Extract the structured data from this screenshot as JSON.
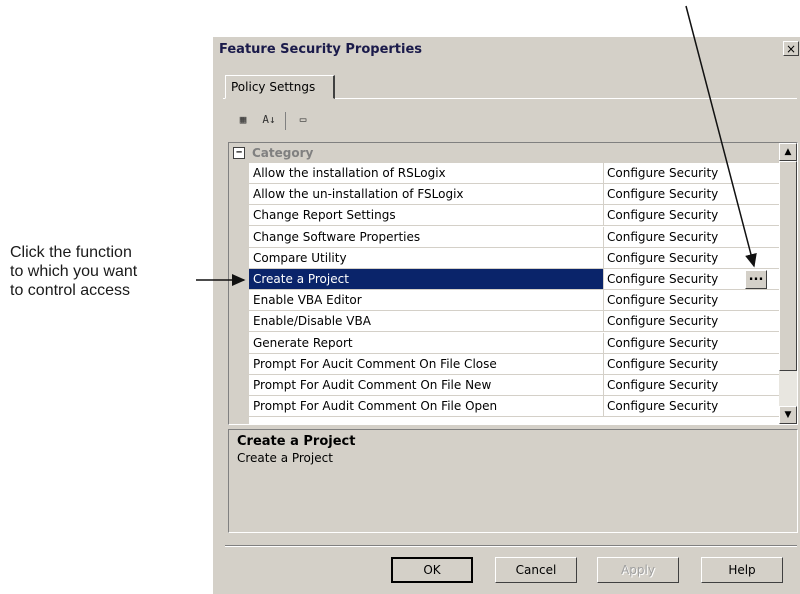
{
  "annotation": {
    "lines": [
      "Click the function",
      "to which you want",
      "to control access"
    ]
  },
  "dialog": {
    "title": "Feature Security Properties",
    "close_label": "×",
    "tab_label": "Policy Settngs",
    "toolbar": {
      "categorized_icon": "categorized-icon",
      "alphabetical_icon": "sort-az-icon",
      "property_pages_icon": "property-pages-icon",
      "categorized_glyph": "▦",
      "alphabetical_glyph": "A↓",
      "pages_glyph": "▭"
    },
    "category": {
      "toggle": "−",
      "label": "Category"
    },
    "rows": [
      {
        "name": "Allow the installation of RSLogix",
        "value": "Configure Security"
      },
      {
        "name": "Allow the un-installation of FSLogix",
        "value": "Configure Security"
      },
      {
        "name": "Change Report Settings",
        "value": "Configure Security"
      },
      {
        "name": "Change Software Properties",
        "value": "Configure Security"
      },
      {
        "name": "Compare Utility",
        "value": "Configure Security"
      },
      {
        "name": "Create a Project",
        "value": "Configure Security"
      },
      {
        "name": "Enable VBA Editor",
        "value": "Configure Security"
      },
      {
        "name": "Enable/Disable VBA",
        "value": "Configure Security"
      },
      {
        "name": "Generate Report",
        "value": "Configure Security"
      },
      {
        "name": "Prompt For Aucit Comment On File Close",
        "value": "Configure Security"
      },
      {
        "name": "Prompt For Audit Comment On File New",
        "value": "Configure Security"
      },
      {
        "name": "Prompt For Audit Comment On File Open",
        "value": "Configure Security"
      }
    ],
    "selected_index": 5,
    "ellipsis_label": "...",
    "scroll_up": "▲",
    "scroll_down": "▼",
    "description": {
      "title": "Create a Project",
      "text": "Create a Project"
    },
    "buttons": {
      "ok": "OK",
      "cancel": "Cancel",
      "apply": "Apply",
      "help": "Help"
    }
  }
}
